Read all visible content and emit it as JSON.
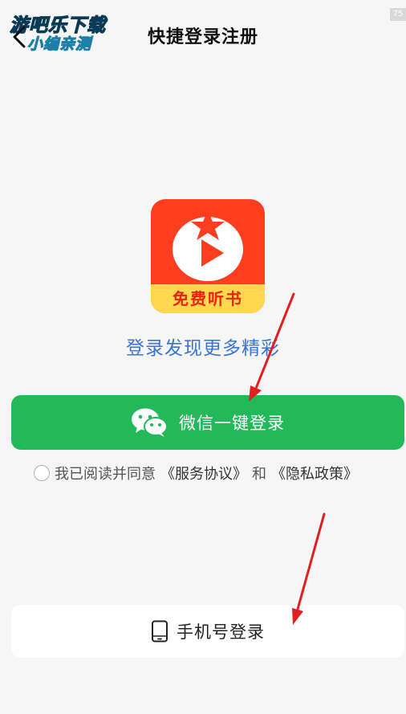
{
  "header": {
    "title": "快捷登录注册",
    "back_icon": "chevron-left-icon"
  },
  "watermark": {
    "line1": "游吧乐下载",
    "line2": "小编亲测"
  },
  "status": {
    "badge": "75"
  },
  "app": {
    "icon_band_text": "免费听书",
    "icon_colors": {
      "background": "#ff3d1f",
      "band": "#ffd84f",
      "play": "#ff3d1f"
    }
  },
  "tagline": "登录发现更多精彩",
  "wechat_login": {
    "label": "微信一键登录",
    "icon": "wechat-icon",
    "color": "#23b85a"
  },
  "agreement": {
    "prefix": "我已阅读并同意",
    "service_link": "《服务协议》",
    "conjunction": "和",
    "privacy_link": "《隐私政策》",
    "checked": false
  },
  "phone_login": {
    "label": "手机号登录",
    "icon": "phone-icon"
  },
  "annotation_color": "#e02020"
}
